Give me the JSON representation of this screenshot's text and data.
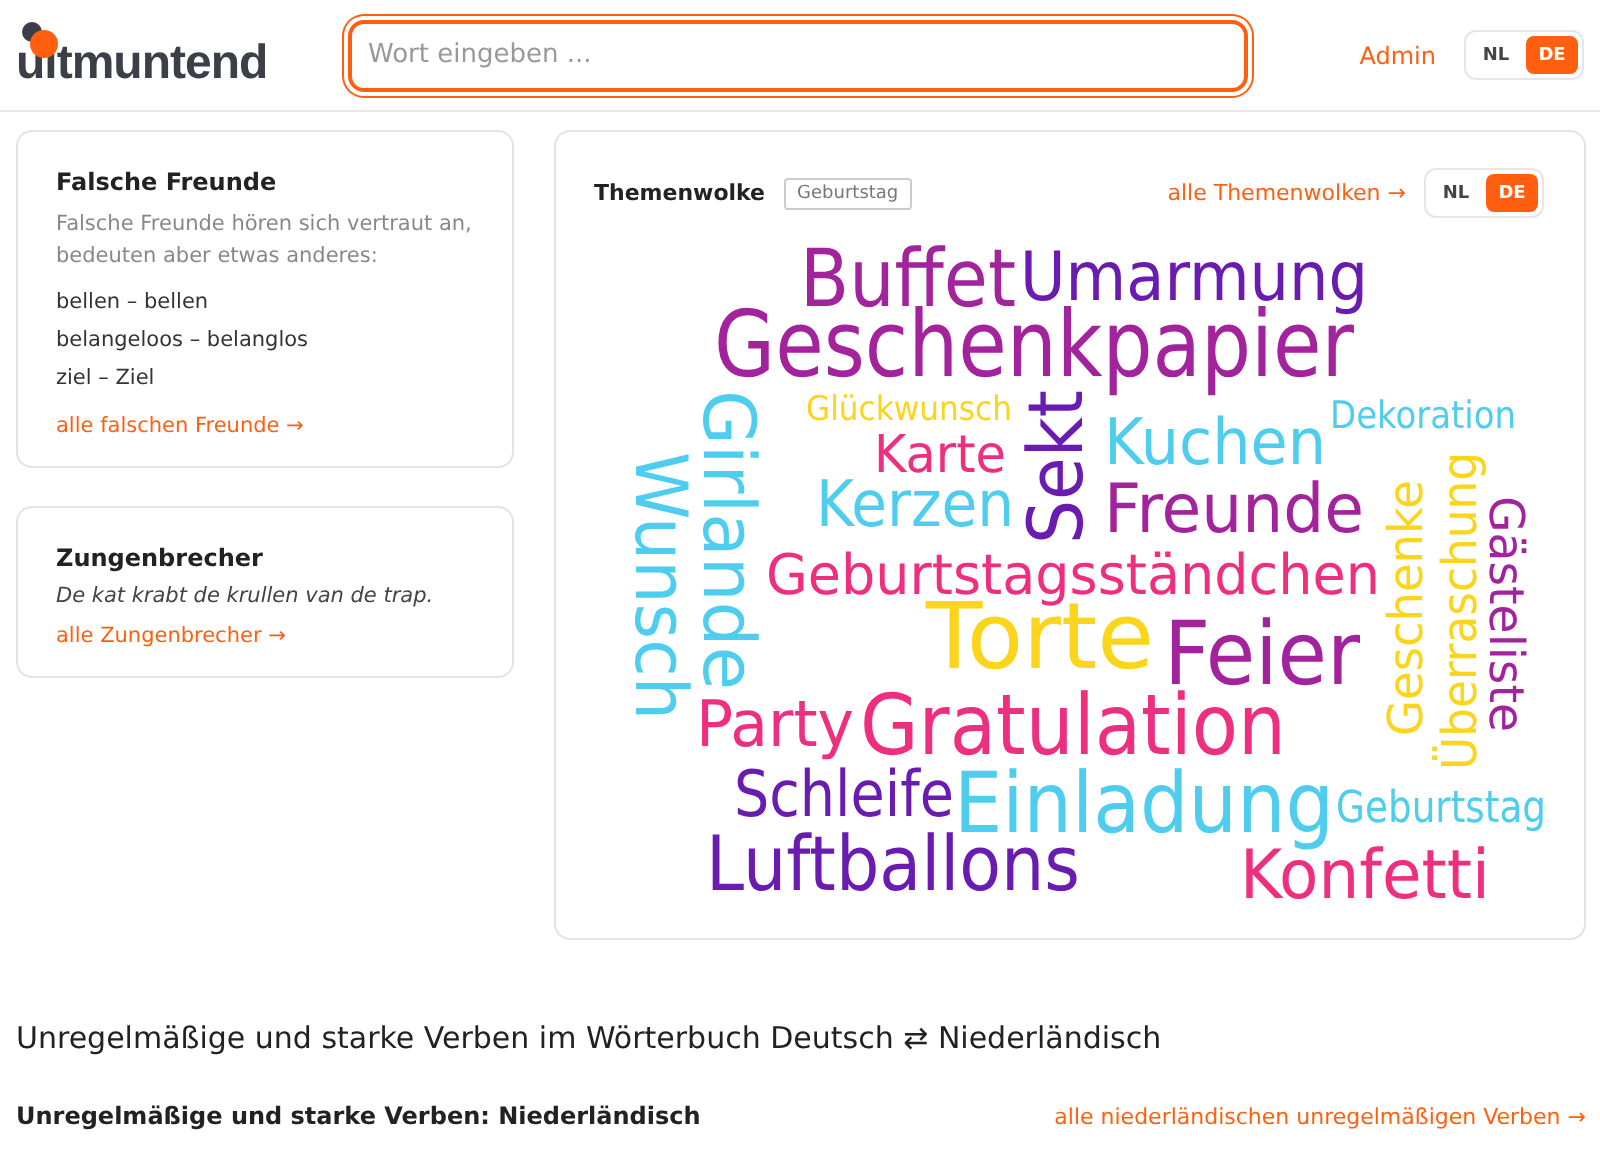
{
  "header": {
    "logo": "uitmuntend",
    "search": {
      "placeholder": "Wort eingeben ..."
    },
    "admin_link": "Admin",
    "language_toggle": [
      {
        "label": "NL",
        "selected": false
      },
      {
        "label": "DE",
        "selected": true
      }
    ]
  },
  "false_friends": {
    "title": "Falsche Freunde",
    "description": "Falsche Freunde hören sich vertraut an, bedeuten aber etwas anderes:",
    "pairs": [
      "bellen – bellen",
      "belangeloos – belanglos",
      "ziel – Ziel"
    ],
    "link": "alle falschen Freunde →"
  },
  "tongue_twister": {
    "title": "Zungenbrecher",
    "text": "De kat krabt de krullen van de trap.",
    "link": "alle Zungenbrecher →"
  },
  "word_cloud": {
    "title": "Themenwolke",
    "tag": "Geburtstag",
    "link": "alle Themenwolken →",
    "language_toggle": [
      {
        "label": "NL",
        "selected": false
      },
      {
        "label": "DE",
        "selected": true
      }
    ],
    "words": [
      {
        "text": "Buffet",
        "color": "#a3239c"
      },
      {
        "text": "Umarmung",
        "color": "#6b1cb0"
      },
      {
        "text": "Geschenkpapier",
        "color": "#a3239c"
      },
      {
        "text": "Glückwunsch",
        "color": "#fbd51c"
      },
      {
        "text": "Dekoration",
        "color": "#4fcdee"
      },
      {
        "text": "Karte",
        "color": "#ee2f80"
      },
      {
        "text": "Kuchen",
        "color": "#4fcdee"
      },
      {
        "text": "Sekt",
        "color": "#6b1cb0"
      },
      {
        "text": "Girlande",
        "color": "#4fcdee"
      },
      {
        "text": "Wunsch",
        "color": "#4fcdee"
      },
      {
        "text": "Kerzen",
        "color": "#4fcdee"
      },
      {
        "text": "Freunde",
        "color": "#a3239c"
      },
      {
        "text": "Geschenke",
        "color": "#fbd51c"
      },
      {
        "text": "Überraschung",
        "color": "#fbd51c"
      },
      {
        "text": "Gästeliste",
        "color": "#a3239c"
      },
      {
        "text": "Geburtstagsständchen",
        "color": "#ee2f80"
      },
      {
        "text": "Torte",
        "color": "#fbd51c"
      },
      {
        "text": "Feier",
        "color": "#a3239c"
      },
      {
        "text": "Party",
        "color": "#ee2f80"
      },
      {
        "text": "Gratulation",
        "color": "#ee2f80"
      },
      {
        "text": "Schleife",
        "color": "#6b1cb0"
      },
      {
        "text": "Einladung",
        "color": "#4fcdee"
      },
      {
        "text": "Geburtstag",
        "color": "#4fcdee"
      },
      {
        "text": "Luftballons",
        "color": "#6b1cb0"
      },
      {
        "text": "Konfetti",
        "color": "#ee2f80"
      }
    ]
  },
  "verbs": {
    "heading": "Unregelmäßige und starke Verben im Wörterbuch Deutsch ⇄ Niederländisch",
    "subheading": "Unregelmäßige und starke Verben: Niederländisch",
    "link": "alle niederländischen unregelmäßigen Verben →"
  }
}
